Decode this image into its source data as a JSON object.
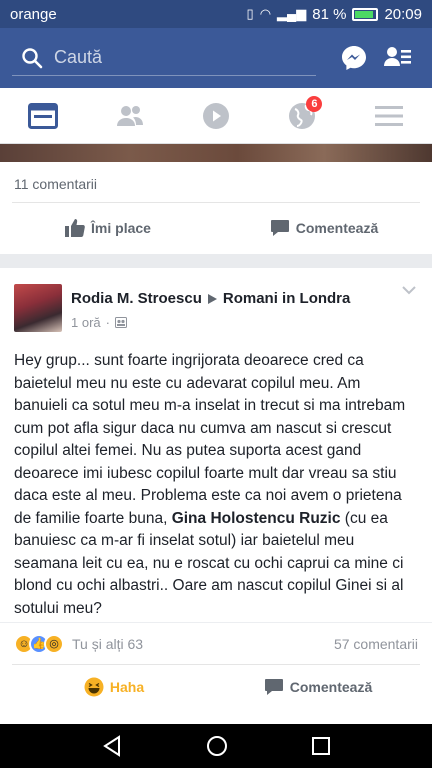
{
  "status_bar": {
    "carrier": "orange",
    "battery": "81 %",
    "time": "20:09",
    "battery_level": 0.81
  },
  "header": {
    "search_placeholder": "Caută"
  },
  "tabs": {
    "notifications_badge": "6"
  },
  "previous_post": {
    "comments_count": "11 comentarii",
    "like_label": "Îmi place",
    "comment_label": "Comentează"
  },
  "post": {
    "author": "Rodia M. Stroescu",
    "group": "Romani in Londra",
    "time": "1 oră",
    "text_1": "Hey grup... sunt foarte ingrijorata deoarece cred ca baietelul meu nu este cu adevarat copilul meu. Am banuieli ca sotul meu m-a inselat in trecut si ma intrebam cum pot afla sigur daca nu cumva am nascut si crescut copilul altei femei. Nu as putea suporta acest gand deoarece imi iubesc copilul foarte mult dar vreau sa stiu daca este al meu. Problema este ca noi avem o prietena de familie foarte buna, ",
    "mention": "Gina Holostencu Ruzic",
    "text_2": " (cu ea banuiesc ca m-ar fi inselat sotul) iar baietelul meu seamana leit cu ea, nu e roscat cu ochi caprui ca mine ci blond cu ochi albastri.. Oare am nascut copilul Ginei si al sotului meu?",
    "reactions_text": "Tu și alți 63",
    "comments_text": "57 comentarii",
    "reaction_label": "Haha",
    "comment_label": "Comentează"
  }
}
